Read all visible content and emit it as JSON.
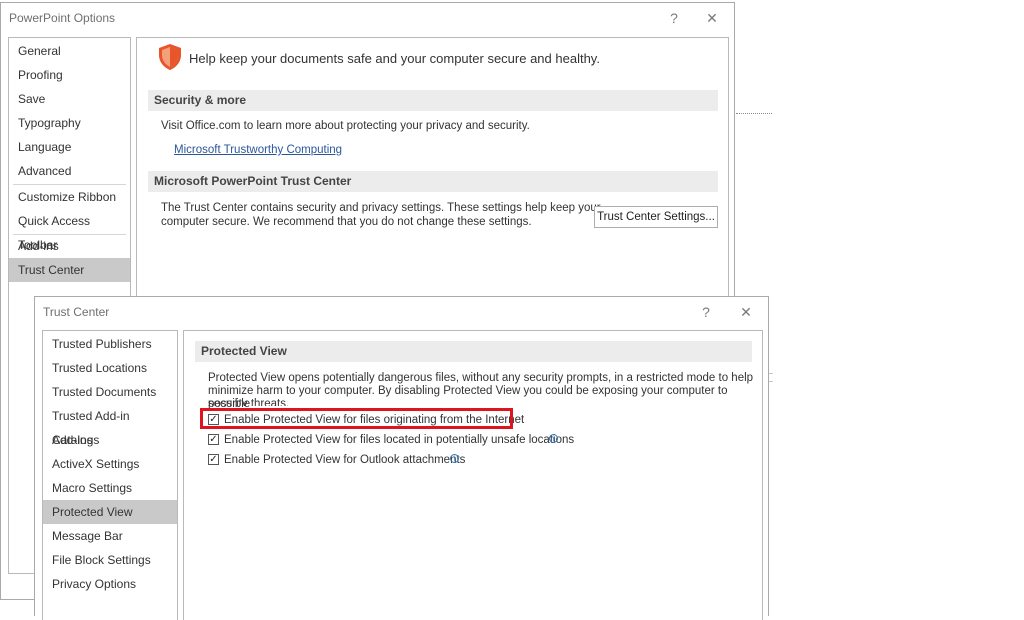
{
  "options_window": {
    "title": "PowerPoint Options",
    "help_glyph": "?",
    "close_glyph": "✕",
    "nav": [
      "General",
      "Proofing",
      "Save",
      "Typography",
      "Language",
      "Advanced",
      "Customize Ribbon",
      "Quick Access Toolbar",
      "Add-ins",
      "Trust Center"
    ],
    "selected_nav": "Trust Center",
    "banner_text": "Help keep your documents safe and your computer secure and healthy.",
    "security_heading": "Security & more",
    "security_text": "Visit Office.com to learn more about protecting your privacy and security.",
    "security_link": "Microsoft Trustworthy Computing",
    "trust_heading": "Microsoft PowerPoint Trust Center",
    "trust_text_line1": "The Trust Center contains security and privacy settings. These settings help keep your",
    "trust_text_line2": "computer secure. We recommend that you do not change these settings.",
    "trust_button": "Trust Center Settings..."
  },
  "trust_window": {
    "title": "Trust Center",
    "help_glyph": "?",
    "close_glyph": "✕",
    "nav": [
      "Trusted Publishers",
      "Trusted Locations",
      "Trusted Documents",
      "Trusted Add-in Catalogs",
      "Add-ins",
      "ActiveX Settings",
      "Macro Settings",
      "Protected View",
      "Message Bar",
      "File Block Settings",
      "Privacy Options"
    ],
    "selected_nav": "Protected View",
    "section_heading": "Protected View",
    "description_line1": "Protected View opens potentially dangerous files, without any security prompts, in a restricted mode to help",
    "description_line2": "minimize harm to your computer. By disabling Protected View you could be exposing your computer to possible",
    "description_line3": "security threats.",
    "checkboxes": [
      {
        "label": "Enable Protected View for files originating from the Internet",
        "checked": true,
        "highlighted": true
      },
      {
        "label": "Enable Protected View for files located in potentially unsafe locations",
        "checked": true,
        "info": true
      },
      {
        "label": "Enable Protected View for Outlook attachments",
        "checked": true,
        "info": true
      }
    ],
    "check_glyph": "✓",
    "info_glyph": "i"
  },
  "colors": {
    "highlight_box": "#e0141e",
    "shield": "#e8552b",
    "link": "#2b579a"
  }
}
